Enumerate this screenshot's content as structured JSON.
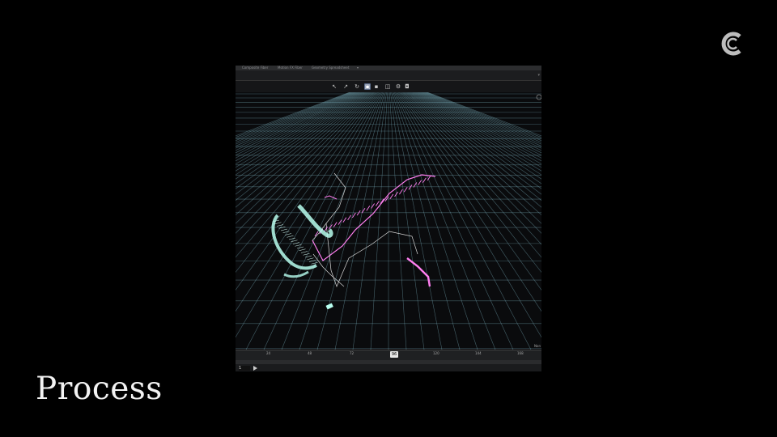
{
  "slide": {
    "title": "Process"
  },
  "app": {
    "tabs": [
      "Composite Fiber",
      "Motion FX Fiber",
      "Geometry Spreadsheet"
    ],
    "viewport_label": "Non",
    "timeline": {
      "ticks": [
        "24",
        "48",
        "72",
        "96",
        "120",
        "144",
        "168"
      ],
      "current_frame": "96",
      "start_frame": "1"
    },
    "colors": {
      "curve": "#ff7ff0",
      "ribbon": "#b8fff0",
      "grid": "#8bc8d8"
    }
  }
}
